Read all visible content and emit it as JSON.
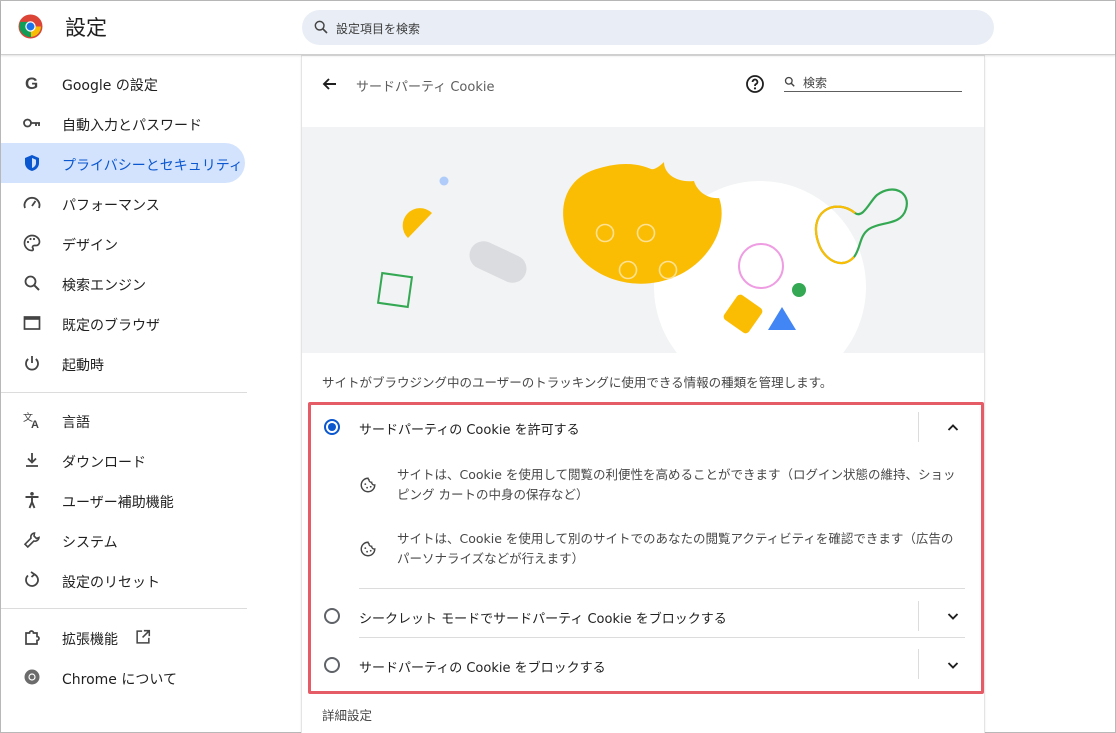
{
  "header": {
    "title": "設定",
    "search_placeholder": "設定項目を検索",
    "logo": "chrome-logo"
  },
  "sidebar": {
    "items": [
      {
        "label": "Google の設定",
        "icon": "google-g-icon"
      },
      {
        "label": "自動入力とパスワード",
        "icon": "key-icon"
      },
      {
        "label": "プライバシーとセキュリティ",
        "icon": "shield-icon",
        "active": true
      },
      {
        "label": "パフォーマンス",
        "icon": "speedometer-icon"
      },
      {
        "label": "デザイン",
        "icon": "palette-icon"
      },
      {
        "label": "検索エンジン",
        "icon": "search-icon"
      },
      {
        "label": "既定のブラウザ",
        "icon": "browser-window-icon"
      },
      {
        "label": "起動時",
        "icon": "power-icon"
      },
      {
        "label": "言語",
        "icon": "translate-icon"
      },
      {
        "label": "ダウンロード",
        "icon": "download-icon"
      },
      {
        "label": "ユーザー補助機能",
        "icon": "accessibility-icon"
      },
      {
        "label": "システム",
        "icon": "wrench-icon"
      },
      {
        "label": "設定のリセット",
        "icon": "reset-icon"
      },
      {
        "label": "拡張機能",
        "icon": "puzzle-icon",
        "external": true
      },
      {
        "label": "Chrome について",
        "icon": "chrome-icon"
      }
    ]
  },
  "page": {
    "title": "サードパーティ Cookie",
    "search_placeholder": "検索",
    "description": "サイトがブラウジング中のユーザーのトラッキングに使用できる情報の種類を管理します。",
    "options": [
      {
        "label": "サードパーティの Cookie を許可する",
        "selected": true,
        "expanded": true,
        "details": [
          "サイトは、Cookie を使用して閲覧の利便性を高めることができます（ログイン状態の維持、ショッピング カートの中身の保存など）",
          "サイトは、Cookie を使用して別のサイトでのあなたの閲覧アクティビティを確認できます（広告のパーソナライズなどが行えます）"
        ]
      },
      {
        "label": "シークレット モードでサードパーティ Cookie をブロックする",
        "selected": false,
        "expanded": false
      },
      {
        "label": "サードパーティの Cookie をブロックする",
        "selected": false,
        "expanded": false
      }
    ],
    "advanced_label": "詳細設定"
  },
  "colors": {
    "accent": "#0b57d0",
    "active_bg": "#d3e3fd",
    "highlight_border": "#e55c66",
    "search_bg": "#e9eef6",
    "cookie": "#fbbc04"
  }
}
